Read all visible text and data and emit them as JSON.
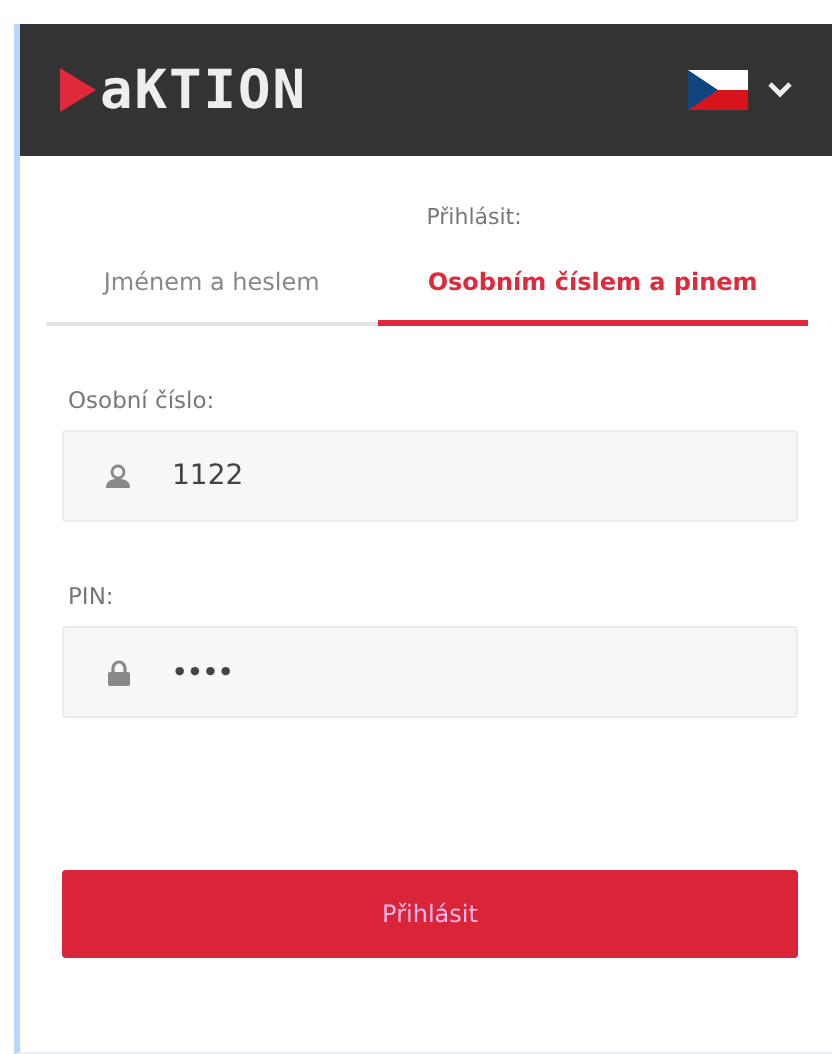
{
  "header": {
    "logo": "aKTION",
    "language": {
      "expanded": false
    }
  },
  "login": {
    "heading": "Přihlásit:",
    "tabs": [
      {
        "label": "Jménem a heslem",
        "selected": false
      },
      {
        "label": "Osobním číslem a pinem",
        "selected": true
      }
    ],
    "fields": [
      {
        "label": "Osobní číslo:",
        "kind": "user",
        "value": "1122"
      },
      {
        "label": "PIN:",
        "kind": "lock",
        "value": "••••"
      }
    ],
    "submit": "Přihlásit"
  }
}
